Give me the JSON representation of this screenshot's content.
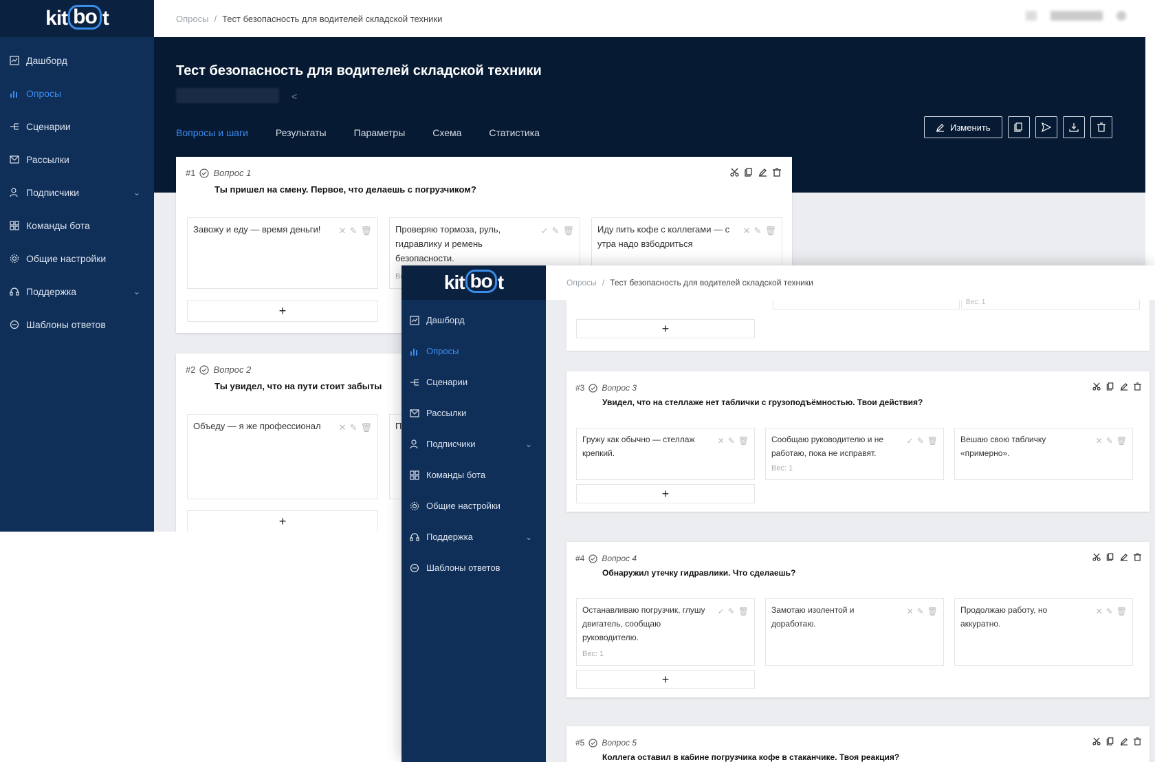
{
  "app": {
    "logo_text_a": "kit",
    "logo_text_b": "bo",
    "logo_text_c": "t",
    "accent": "#3d8cf0",
    "sidebar_bg": "#0f2e58",
    "hero_bg": "#071a33"
  },
  "sidebar": {
    "items": [
      {
        "label": "Дашборд",
        "icon": "dashboard-icon"
      },
      {
        "label": "Опросы",
        "icon": "chart-icon",
        "active": true
      },
      {
        "label": "Сценарии",
        "icon": "scenario-icon"
      },
      {
        "label": "Рассылки",
        "icon": "mail-icon"
      },
      {
        "label": "Подписчики",
        "icon": "users-icon",
        "expandable": true
      },
      {
        "label": "Команды бота",
        "icon": "grid-icon"
      },
      {
        "label": "Общие настройки",
        "icon": "gear-icon"
      },
      {
        "label": "Поддержка",
        "icon": "headset-icon",
        "expandable": true
      },
      {
        "label": "Шаблоны ответов",
        "icon": "chat-icon"
      }
    ]
  },
  "breadcrumb": {
    "root": "Опросы",
    "current": "Тест безопасность для водителей складской техники"
  },
  "page": {
    "title": "Тест безопасность для водителей складской техники",
    "tabs": [
      "Вопросы и шаги",
      "Результаты",
      "Параметры",
      "Схема",
      "Статистика"
    ],
    "edit_label": "Изменить"
  },
  "questions": [
    {
      "num": "#1",
      "label": "Вопрос 1",
      "text": "Ты пришел на смену. Первое, что делаешь с погрузчиком?",
      "answers": [
        {
          "text": "Завожу и еду — время деньги!",
          "correct": false
        },
        {
          "text": "Проверяю тормоза, руль, гидравлику и ремень безопасности.",
          "correct": true,
          "weight": "Вес: 1"
        },
        {
          "text": "Иду пить кофе с коллегами — с утра надо взбодриться",
          "correct": false
        }
      ]
    },
    {
      "num": "#2",
      "label": "Вопрос 2",
      "text": "Ты увидел, что на пути стоит забыты",
      "answers": [
        {
          "text": "Объеду — я же профессионал",
          "correct": false
        },
        {
          "text": "П н",
          "correct": false
        }
      ]
    },
    {
      "num": "#3",
      "label": "Вопрос 3",
      "text": "Увидел, что на стеллаже нет таблички с грузоподъёмностью. Твои действия?",
      "answers": [
        {
          "text": "Гружу как обычно — стеллаж крепкий.",
          "correct": false
        },
        {
          "text": "Сообщаю руководителю и не работаю, пока не исправят.",
          "correct": true,
          "weight": "Вес: 1"
        },
        {
          "text": "Вешаю свою табличку «примерно».",
          "correct": false
        }
      ]
    },
    {
      "num": "#4",
      "label": "Вопрос 4",
      "text": "Обнаружил утечку гидравлики. Что сделаешь?",
      "answers": [
        {
          "text": "Останавливаю погрузчик, глушу двигатель, сообщаю руководителю.",
          "correct": true,
          "weight": "Вес: 1"
        },
        {
          "text": "Замотаю изолентой и доработаю.",
          "correct": false
        },
        {
          "text": "Продолжаю работу, но аккуратно.",
          "correct": false
        }
      ]
    },
    {
      "num": "#5",
      "label": "Вопрос 5",
      "text": "Коллега оставил в кабине погрузчика кофе в стаканчике. Твоя реакция?"
    }
  ],
  "prev_card": {
    "weight": "Вес: 1"
  },
  "add_label": "+"
}
